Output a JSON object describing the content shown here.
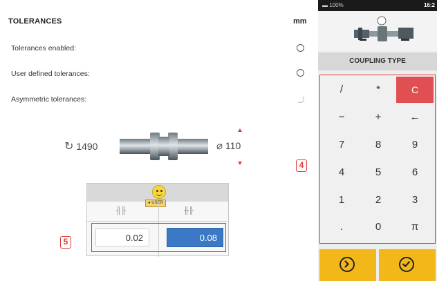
{
  "header": {
    "title": "TOLERANCES",
    "unit": "mm"
  },
  "options": [
    {
      "label": "Tolerances enabled:"
    },
    {
      "label": "User defined tolerances:"
    },
    {
      "label": "Asymmetric tolerances:"
    }
  ],
  "machine": {
    "rpm": "1490",
    "diameter": "110"
  },
  "tolerances": {
    "user_badge": "USER",
    "value_left": "0.02",
    "value_right": "0.08"
  },
  "callouts": {
    "keypad": "4",
    "values": "5"
  },
  "device": {
    "status_left": "▬ 100%",
    "status_time": "16:2",
    "panel_title": "COUPLING TYPE",
    "keys": [
      [
        "/",
        "*",
        "C"
      ],
      [
        "−",
        "+",
        "←"
      ],
      [
        "7",
        "8",
        "9"
      ],
      [
        "4",
        "5",
        "6"
      ],
      [
        "1",
        "2",
        "3"
      ],
      [
        ".",
        "0",
        "π"
      ]
    ]
  },
  "icons": {
    "speed": "rotate-icon",
    "diameter": "diameter-icon",
    "next": "next-circle-icon",
    "confirm": "check-circle-icon"
  },
  "colors": {
    "accent_red": "#e03a3a",
    "value_blue": "#3b79c6",
    "footer_yellow": "#f2b719",
    "clear_key": "#e05052"
  }
}
